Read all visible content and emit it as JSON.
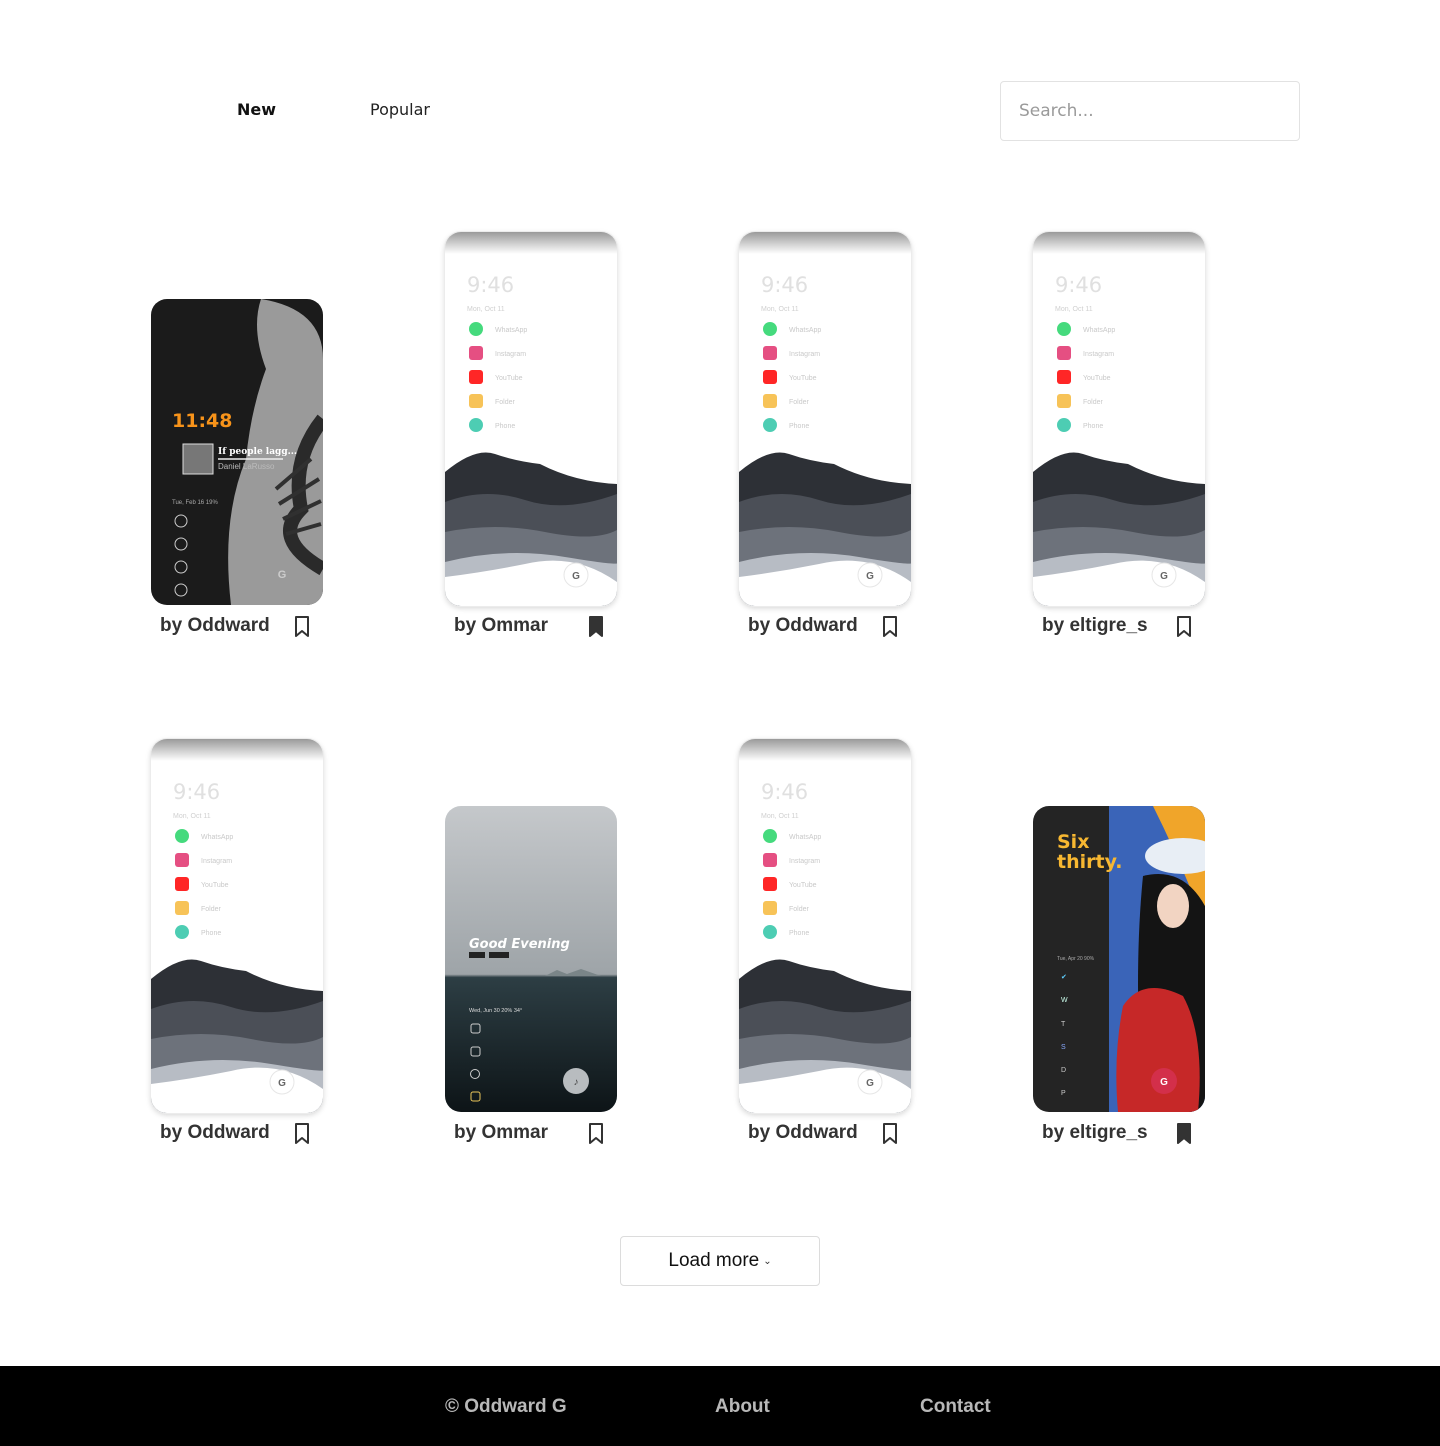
{
  "nav": {
    "tabs": [
      {
        "label": "New",
        "active": true
      },
      {
        "label": "Popular",
        "active": false
      }
    ]
  },
  "search": {
    "placeholder": "Search...",
    "value": ""
  },
  "cards": [
    {
      "author": "by Oddward",
      "bookmarked": false,
      "preview": "dark-fern",
      "clock": "11:48",
      "song": "If people lagg...",
      "artist": "Daniel LaRusso",
      "status": "Tue, Feb 16  19%"
    },
    {
      "author": "by Ommar",
      "bookmarked": true,
      "preview": "mountains",
      "clock": "9:46",
      "date": "Mon, Oct 11",
      "apps": [
        "WhatsApp",
        "Instagram",
        "YouTube",
        "Folder",
        "Phone"
      ]
    },
    {
      "author": "by Oddward",
      "bookmarked": false,
      "preview": "mountains",
      "clock": "9:46",
      "date": "Mon, Oct 11",
      "apps": [
        "WhatsApp",
        "Instagram",
        "YouTube",
        "Folder",
        "Phone"
      ]
    },
    {
      "author": "by eltigre_s",
      "bookmarked": false,
      "preview": "mountains",
      "clock": "9:46",
      "date": "Mon, Oct 11",
      "apps": [
        "WhatsApp",
        "Instagram",
        "YouTube",
        "Folder",
        "Phone"
      ]
    },
    {
      "author": "by Oddward",
      "bookmarked": false,
      "preview": "mountains",
      "clock": "9:46",
      "date": "Mon, Oct 11",
      "apps": [
        "WhatsApp",
        "Instagram",
        "YouTube",
        "Folder",
        "Phone"
      ]
    },
    {
      "author": "by Ommar",
      "bookmarked": false,
      "preview": "sea",
      "greeting": "Good Evening",
      "status": "Wed, Jun 30  20%  34°"
    },
    {
      "author": "by Oddward",
      "bookmarked": false,
      "preview": "mountains",
      "clock": "9:46",
      "date": "Mon, Oct 11",
      "apps": [
        "WhatsApp",
        "Instagram",
        "YouTube",
        "Folder",
        "Phone"
      ]
    },
    {
      "author": "by eltigre_s",
      "bookmarked": true,
      "preview": "anime",
      "title_line1": "Six",
      "title_line2": "thirty.",
      "status": "Tue, Apr 20  90%"
    }
  ],
  "load_more": {
    "label": "Load more",
    "icon": "chevron-down-icon"
  },
  "footer": {
    "copyright": "© Oddward G",
    "links": [
      "About",
      "Contact"
    ]
  },
  "colors": {
    "footer_bg": "#000000",
    "footer_text": "#b8b8b8",
    "author_text": "#333333",
    "accent_orange": "#f7931a"
  }
}
